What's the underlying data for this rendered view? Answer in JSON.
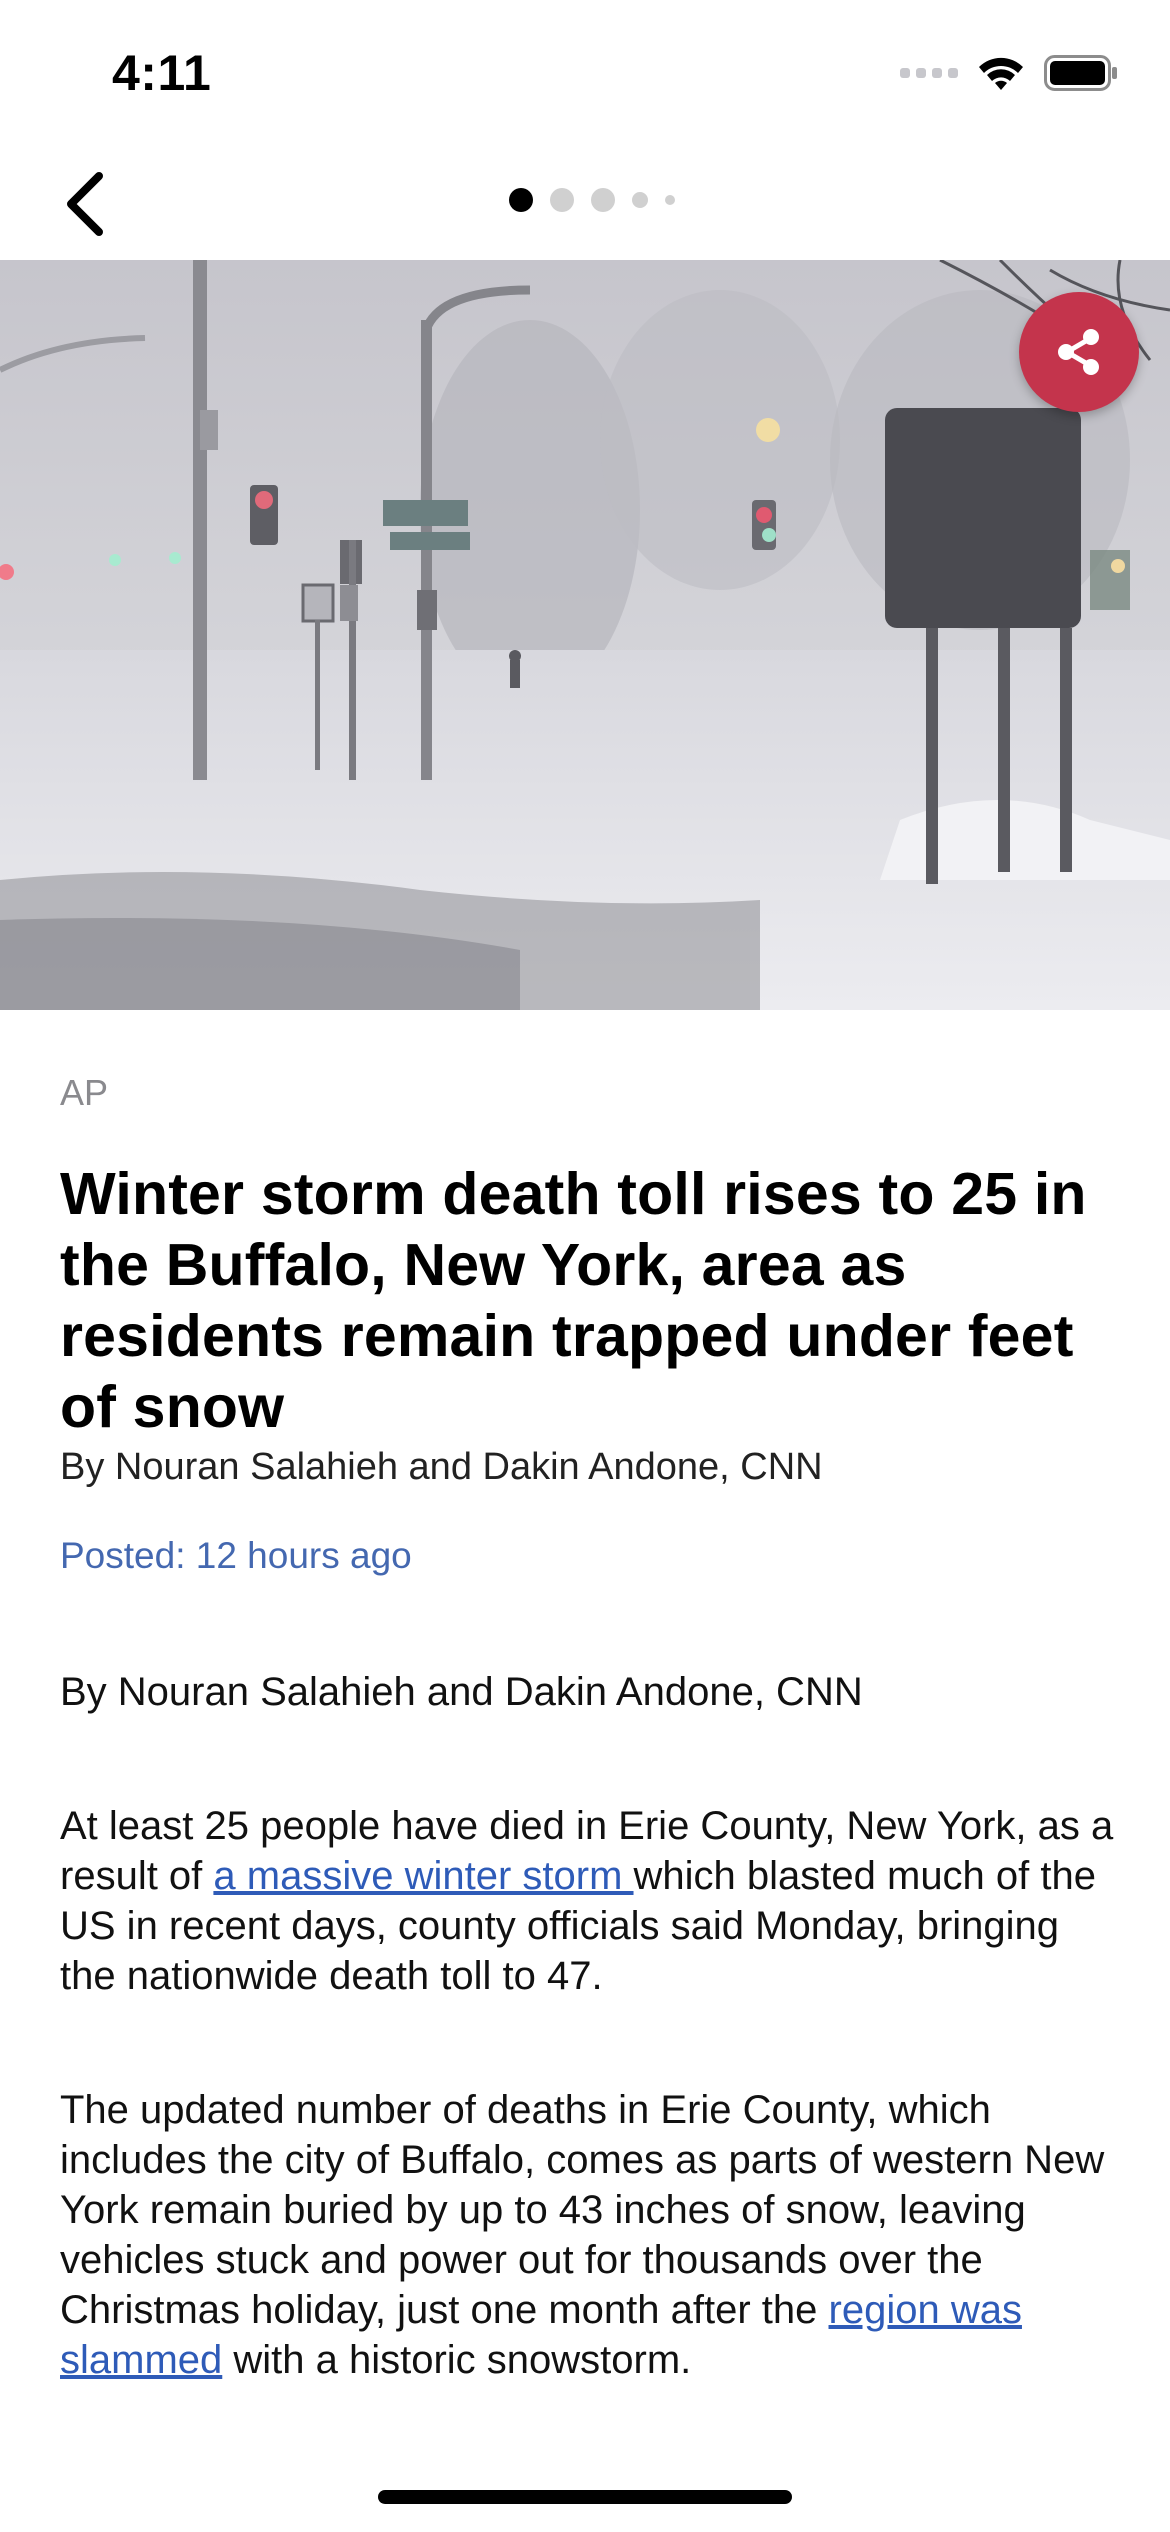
{
  "status_bar": {
    "time": "4:11"
  },
  "nav": {
    "page_count": 5,
    "active_index": 0
  },
  "article": {
    "source": "AP",
    "headline": "Winter storm death toll rises to 25 in the Buffalo, New York, area as residents remain trapped under feet of snow",
    "byline": "By Nouran Salahieh and Dakin Andone, CNN",
    "posted": "Posted: 12 hours ago",
    "body_byline": "By Nouran Salahieh and Dakin Andone, CNN",
    "p2": {
      "before": "At least 25 people have died in Erie County, New York, as a result of ",
      "link": "a massive winter storm ",
      "after": "which blasted much of the US in recent days, county officials said Monday, bringing the nationwide death toll to 47."
    },
    "p3": {
      "before": "The updated number of deaths in Erie County, which includes the city of Buffalo, comes as parts of western New York remain buried by up to 43 inches of snow, leaving vehicles stuck and power out for thousands over the Christmas holiday, just one month after the ",
      "link": "region was slammed",
      "after": " with a historic snowstorm."
    }
  },
  "icons": {
    "back": "chevron-left-icon",
    "share": "share-icon",
    "wifi": "wifi-icon",
    "battery": "battery-icon",
    "signal": "cellular-signal-icon"
  },
  "colors": {
    "share_button": "#c4344c",
    "link": "#2e5bb8",
    "posted": "#4468b0",
    "source": "#8a8a8e"
  }
}
